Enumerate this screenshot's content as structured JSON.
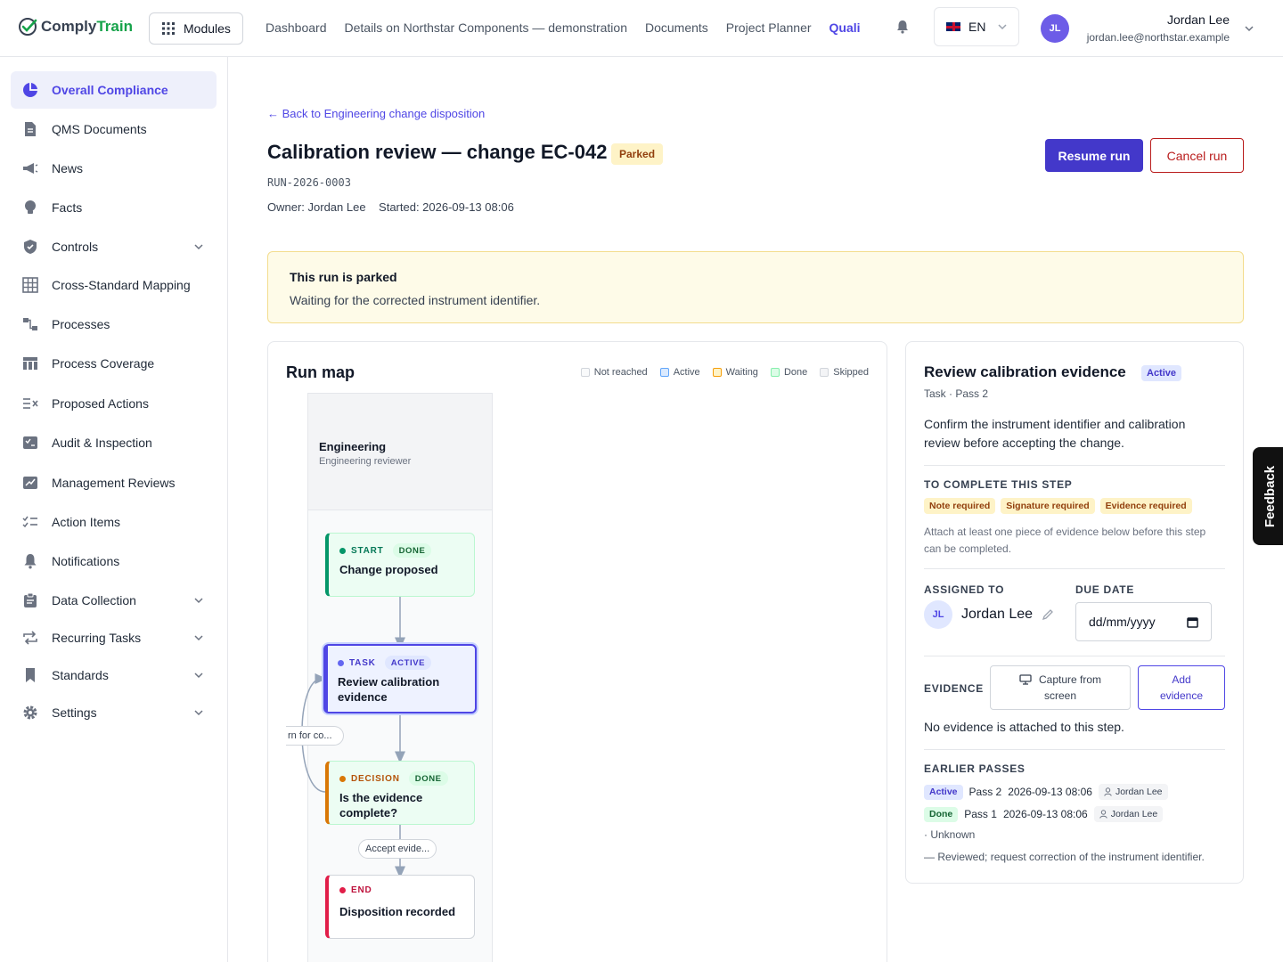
{
  "app": {
    "logo_part1": "Comply",
    "logo_part2": "Train",
    "modules_label": "Modules"
  },
  "nav": {
    "items": [
      "Dashboard",
      "Details on Northstar Components — demonstration",
      "Documents",
      "Project Planner",
      "Quali"
    ],
    "active_index": 4
  },
  "language": {
    "code": "EN"
  },
  "user": {
    "initials": "JL",
    "name": "Jordan Lee",
    "email": "jordan.lee@northstar.example"
  },
  "sidebar": {
    "items": [
      {
        "label": "Overall Compliance",
        "icon": "pie-chart-icon",
        "active": true,
        "expandable": false
      },
      {
        "label": "QMS Documents",
        "icon": "document-icon",
        "active": false,
        "expandable": false
      },
      {
        "label": "News",
        "icon": "megaphone-icon",
        "active": false,
        "expandable": false
      },
      {
        "label": "Facts",
        "icon": "lightbulb-icon",
        "active": false,
        "expandable": false
      },
      {
        "label": "Controls",
        "icon": "shield-icon",
        "active": false,
        "expandable": true
      },
      {
        "label": "Cross-Standard Mapping",
        "icon": "grid-icon",
        "active": false,
        "expandable": false
      },
      {
        "label": "Processes",
        "icon": "flow-icon",
        "active": false,
        "expandable": false
      },
      {
        "label": "Process Coverage",
        "icon": "table-icon",
        "active": false,
        "expandable": false
      },
      {
        "label": "Proposed Actions",
        "icon": "list-x-icon",
        "active": false,
        "expandable": false
      },
      {
        "label": "Audit & Inspection",
        "icon": "checklist-icon",
        "active": false,
        "expandable": false
      },
      {
        "label": "Management Reviews",
        "icon": "chart-icon",
        "active": false,
        "expandable": false
      },
      {
        "label": "Action Items",
        "icon": "list-check-icon",
        "active": false,
        "expandable": false
      },
      {
        "label": "Notifications",
        "icon": "bell-icon",
        "active": false,
        "expandable": false
      },
      {
        "label": "Data Collection",
        "icon": "clipboard-icon",
        "active": false,
        "expandable": true
      },
      {
        "label": "Recurring Tasks",
        "icon": "repeat-icon",
        "active": false,
        "expandable": true
      },
      {
        "label": "Standards",
        "icon": "bookmark-icon",
        "active": false,
        "expandable": true
      },
      {
        "label": "Settings",
        "icon": "gear-icon",
        "active": false,
        "expandable": true
      }
    ]
  },
  "page": {
    "back_link": "← Back to Engineering change disposition",
    "title": "Calibration review — change EC-042",
    "status": "Parked",
    "run_id": "RUN-2026-0003",
    "owner": "Owner: Jordan Lee",
    "started": "Started: 2026-09-13 08:06",
    "resume_label": "Resume run",
    "cancel_label": "Cancel run"
  },
  "banner": {
    "title": "This run is parked",
    "text": "Waiting for the corrected instrument identifier."
  },
  "runmap": {
    "title": "Run map",
    "legend": [
      {
        "label": "Not reached",
        "fill": "#f9fafb",
        "border": "#d1d5db"
      },
      {
        "label": "Active",
        "fill": "#dbeafe",
        "border": "#60a5fa"
      },
      {
        "label": "Waiting",
        "fill": "#fef3c7",
        "border": "#f59e0b"
      },
      {
        "label": "Done",
        "fill": "#dcfce7",
        "border": "#86efac"
      },
      {
        "label": "Skipped",
        "fill": "#f3f4f6",
        "border": "#d1d5db"
      }
    ],
    "lane": {
      "name": "Engineering",
      "role": "Engineering reviewer"
    },
    "nodes": [
      {
        "kind": "START",
        "status": "DONE",
        "label": "Change proposed"
      },
      {
        "kind": "TASK",
        "status": "ACTIVE",
        "label": "Review calibration evidence"
      },
      {
        "kind": "DECISION",
        "status": "DONE",
        "label": "Is the evidence complete?"
      },
      {
        "kind": "END",
        "status": "",
        "label": "Disposition recorded"
      }
    ],
    "edge_labels": [
      "rn for co...",
      "Accept evide..."
    ]
  },
  "detail": {
    "title": "Review calibration evidence",
    "status": "Active",
    "subtitle": "Task · Pass 2",
    "description": "Confirm the instrument identifier and calibration review before accepting the change.",
    "complete_label": "TO COMPLETE THIS STEP",
    "requirements": [
      "Note required",
      "Signature required",
      "Evidence required"
    ],
    "requirement_note": "Attach at least one piece of evidence below before this step can be completed.",
    "assigned_label": "ASSIGNED TO",
    "assignee_initials": "JL",
    "assignee_name": "Jordan Lee",
    "due_label": "DUE DATE",
    "due_placeholder": "dd/mm/yyyy",
    "evidence_label": "EVIDENCE",
    "capture_label_1": "Capture from",
    "capture_label_2": "screen",
    "add_label_1": "Add",
    "add_label_2": "evidence",
    "no_evidence": "No evidence is attached to this step.",
    "earlier_label": "EARLIER PASSES",
    "passes": [
      {
        "status": "Active",
        "pass": "Pass 2",
        "time": "2026-09-13 08:06",
        "user": "Jordan Lee"
      },
      {
        "status": "Done",
        "pass": "Pass 1",
        "time": "2026-09-13 08:06",
        "user": "Jordan Lee"
      }
    ],
    "pass_outcome": "· Unknown",
    "pass_note": "— Reviewed; request correction of the instrument identifier."
  },
  "feedback_label": "Feedback"
}
